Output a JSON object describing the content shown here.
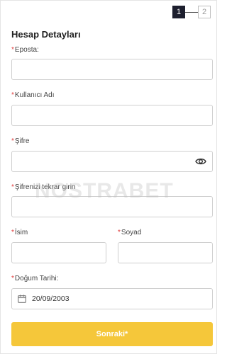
{
  "stepper": {
    "step1": "1",
    "step2": "2"
  },
  "title": "Hesap Detayları",
  "required_mark": "*",
  "fields": {
    "email": {
      "label": "Eposta:",
      "value": ""
    },
    "username": {
      "label": "Kullanıcı Adı",
      "value": ""
    },
    "password": {
      "label": "Şifre",
      "value": ""
    },
    "password_repeat": {
      "label": "Şifrenizi tekrar girin",
      "value": ""
    },
    "first_name": {
      "label": "İsim",
      "value": ""
    },
    "last_name": {
      "label": "Soyad",
      "value": ""
    },
    "birth_date": {
      "label": "Doğum Tarihi:",
      "value": "20/09/2003"
    }
  },
  "submit_label": "Sonraki*",
  "watermark": "NOSTRABET",
  "colors": {
    "accent": "#f5c73a",
    "required": "#e03a3a",
    "step_active": "#1d1f2e"
  },
  "icons": {
    "password_toggle": "eye-icon",
    "date": "calendar-icon"
  }
}
